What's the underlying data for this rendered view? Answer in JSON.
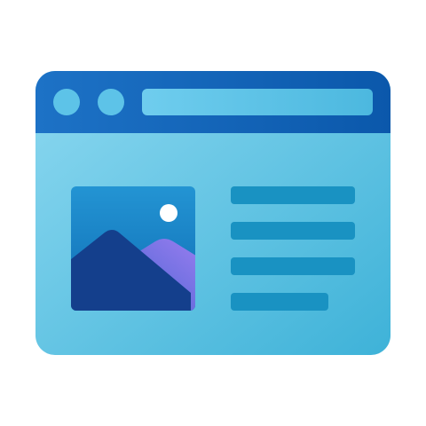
{
  "icon": {
    "name": "web-page-icon",
    "colors": {
      "titlebar_top": "#1a6fc4",
      "titlebar_bottom": "#0d5bb0",
      "window_body_light": "#8ad6ee",
      "window_body_dark": "#3fb3d8",
      "window_dot": "#5cc2e6",
      "address_bar": "#5cc2e6",
      "image_bg_top": "#1f8fd0",
      "image_bg_bottom": "#0e6fb8",
      "mountain_back_light": "#9b7ef0",
      "mountain_back_dark": "#4b6dd6",
      "mountain_front": "#143f8c",
      "sun": "#ffffff",
      "text_line": "#1992c2"
    },
    "text_lines": 4
  }
}
